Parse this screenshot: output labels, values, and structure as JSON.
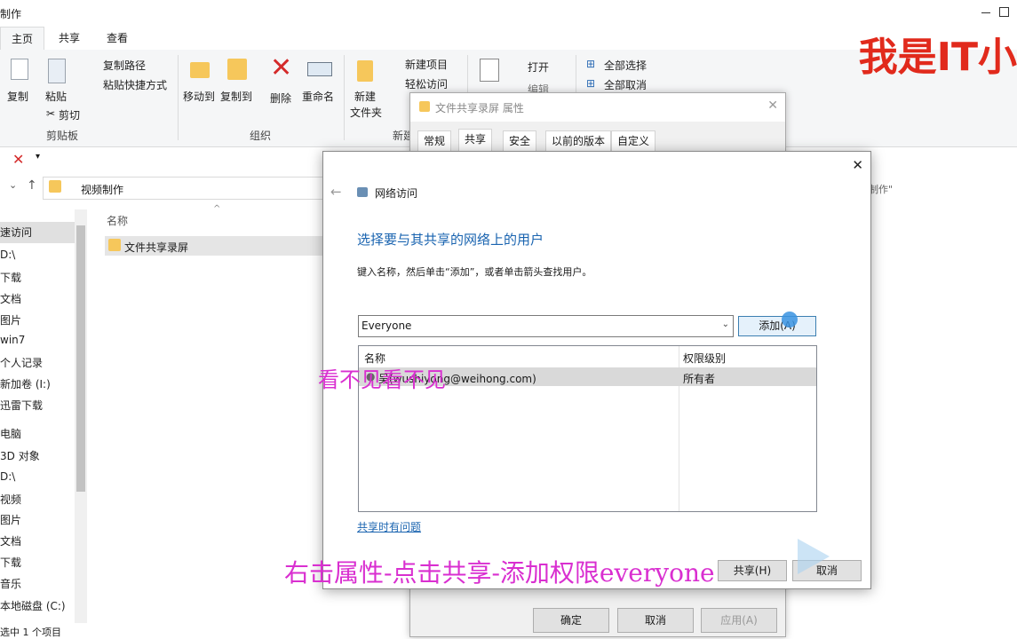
{
  "window": {
    "title_fragment": "制作"
  },
  "ribbon": {
    "tabs": [
      "主页",
      "共享",
      "查看"
    ],
    "clipboard": {
      "copy": "复制",
      "paste": "粘贴",
      "copy_path": "复制路径",
      "paste_shortcut": "粘贴快捷方式",
      "cut": "剪切",
      "label": "剪贴板"
    },
    "organize": {
      "move_to": "移动到",
      "copy_to": "复制到",
      "delete": "删除",
      "rename": "重命名",
      "label": "组织"
    },
    "new": {
      "new_folder_line1": "新建",
      "new_folder_line2": "文件夹",
      "new_item": "新建项目",
      "easy_access": "轻松访问",
      "label": "新建"
    },
    "open": {
      "open": "打开",
      "edit": "编辑"
    },
    "select": {
      "select_all": "全部选择",
      "select_none": "全部取消"
    }
  },
  "address": {
    "path": "视频制作",
    "search_hint": "制作\""
  },
  "nav": {
    "items": [
      "速访问",
      "D:\\",
      "下载",
      "文档",
      "图片",
      "win7",
      "个人记录",
      "新加卷 (I:)",
      "迅雷下载",
      "电脑",
      "3D 对象",
      "D:\\",
      "视频",
      "图片",
      "文档",
      "下载",
      "音乐",
      "本地磁盘 (C:)"
    ]
  },
  "status": {
    "text": "选中 1 个项目"
  },
  "file_list": {
    "column_name": "名称",
    "items": [
      "文件共享录屏"
    ]
  },
  "props_dialog": {
    "title": "文件共享录屏 属性",
    "tabs": [
      "常规",
      "共享",
      "安全",
      "以前的版本",
      "自定义"
    ],
    "buttons": {
      "ok": "确定",
      "cancel": "取消",
      "apply": "应用(A)"
    }
  },
  "net_dialog": {
    "header": "网络访问",
    "heading": "选择要与其共享的网络上的用户",
    "instruction": "键入名称，然后单击“添加”，或者单击箭头查找用户。",
    "combo_value": "Everyone",
    "add_button": "添加(A)",
    "table": {
      "col_name": "名称",
      "col_perm": "权限级别",
      "rows": [
        {
          "name": "吴(wushiyong@weihong.com)",
          "perm": "所有者"
        }
      ]
    },
    "help_link": "共享时有问题",
    "share_button": "共享(H)",
    "cancel_button": "取消"
  },
  "overlays": {
    "caption_mid": "看不见看不见",
    "caption_bottom": "右击属性-点击共享-添加权限everyone",
    "watermark": "我是IT小"
  },
  "colors": {
    "accent": "#1a64b0",
    "overlay": "#d92fd0",
    "watermark": "#e12a1c"
  }
}
